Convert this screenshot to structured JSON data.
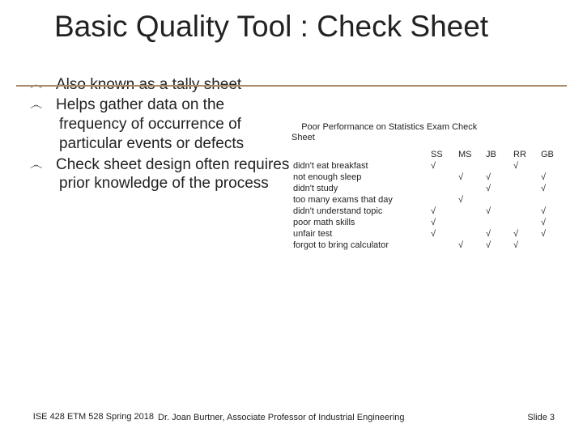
{
  "title": "Basic Quality Tool : Check Sheet",
  "bullets": [
    "Also known as a tally sheet",
    "Helps gather data on the frequency of occurrence of particular events or defects",
    "Check sheet design often requires prior knowledge of the process"
  ],
  "bullet_glyph": "෴",
  "table": {
    "caption_indent": "    Poor Performance on Statistics Exam Check",
    "caption_line2": "Sheet",
    "columns": [
      "SS",
      "MS",
      "JB",
      "RR",
      "GB"
    ],
    "rows": [
      {
        "label": "didn't eat breakfast",
        "marks": [
          "√",
          "",
          "",
          "√",
          ""
        ]
      },
      {
        "label": "not enough sleep",
        "marks": [
          "",
          "√",
          "√",
          "",
          "√"
        ]
      },
      {
        "label": "didn't study",
        "marks": [
          "",
          "",
          "√",
          "",
          "√"
        ]
      },
      {
        "label": "too many exams that day",
        "marks": [
          "",
          "√",
          "",
          "",
          ""
        ]
      },
      {
        "label": "didn't understand topic",
        "marks": [
          "√",
          "",
          "√",
          "",
          "√"
        ]
      },
      {
        "label": "poor math skills",
        "marks": [
          "√",
          "",
          "",
          "",
          "√"
        ]
      },
      {
        "label": "unfair test",
        "marks": [
          "√",
          "",
          "√",
          "√",
          "√"
        ]
      },
      {
        "label": "forgot to bring calculator",
        "marks": [
          "",
          "√",
          "√",
          "√",
          ""
        ]
      }
    ]
  },
  "footer": {
    "left": "ISE 428 ETM 528 Spring 2018",
    "center": "Dr. Joan Burtner, Associate Professor of Industrial Engineering",
    "right": "Slide 3"
  }
}
